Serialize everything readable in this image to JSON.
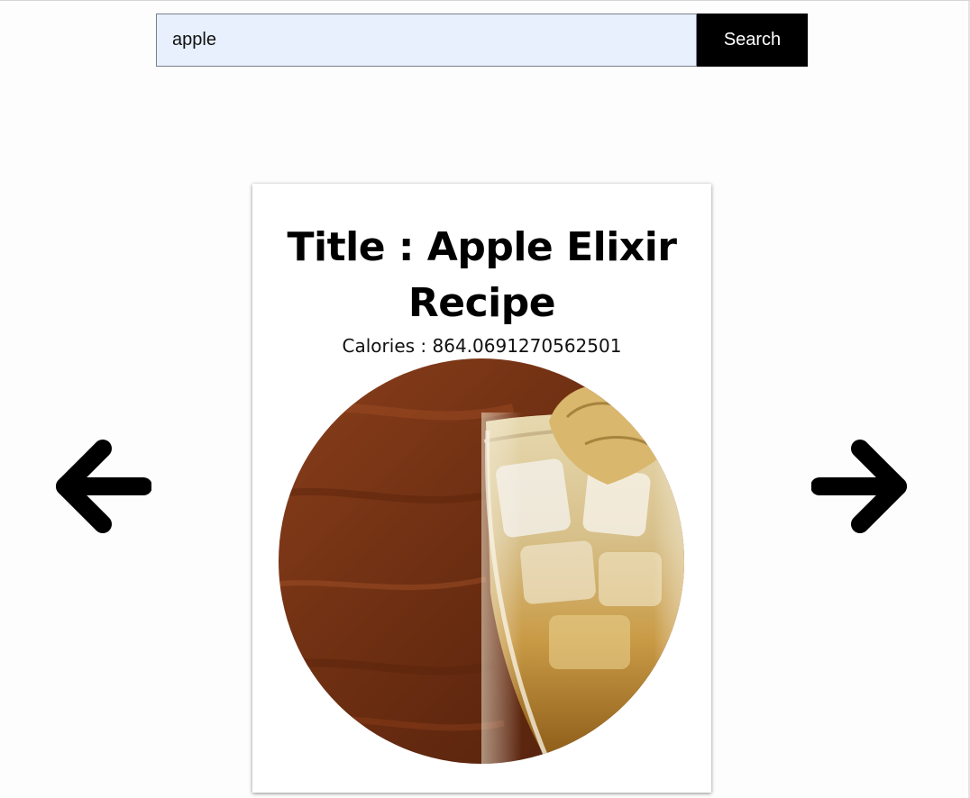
{
  "search": {
    "value": "apple",
    "button_label": "Search"
  },
  "carousel": {
    "prev_icon": "arrow-left-icon",
    "next_icon": "arrow-right-icon"
  },
  "recipe": {
    "title": "Title : Apple Elixir Recipe",
    "calories": "Calories : 864.0691270562501",
    "image_subject": "apple-elixir-drink"
  },
  "colors": {
    "search_input_bg": "#e8f0fe",
    "search_button_bg": "#000000",
    "search_button_text": "#ffffff",
    "card_bg": "#ffffff",
    "arrow": "#000000"
  }
}
